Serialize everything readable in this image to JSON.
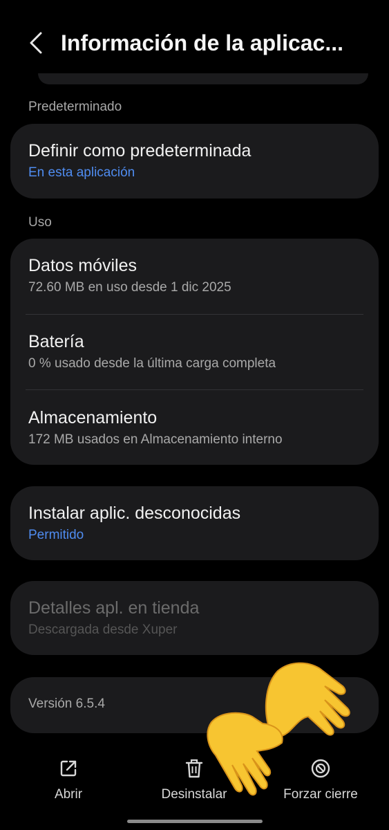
{
  "header": {
    "title": "Información de la aplicac...",
    "back_icon": "chevron-left-icon"
  },
  "sections": {
    "default_label": "Predeterminado",
    "usage_label": "Uso"
  },
  "default_card": {
    "title": "Definir como predeterminada",
    "subtitle": "En esta aplicación"
  },
  "usage": {
    "mobile_data": {
      "title": "Datos móviles",
      "subtitle": "72.60 MB en uso desde 1 dic 2025"
    },
    "battery": {
      "title": "Batería",
      "subtitle": "0 % usado desde la última carga completa"
    },
    "storage": {
      "title": "Almacenamiento",
      "subtitle": "172 MB usados en Almacenamiento interno"
    }
  },
  "install_unknown": {
    "title": "Instalar aplic. desconocidas",
    "subtitle": "Permitido"
  },
  "store_details": {
    "title": "Detalles apl. en tienda",
    "subtitle": "Descargada desde Xuper"
  },
  "version": {
    "text": "Versión 6.5.4"
  },
  "actions": {
    "open": {
      "label": "Abrir",
      "icon": "open-external-icon"
    },
    "uninstall": {
      "label": "Desinstalar",
      "icon": "trash-icon"
    },
    "force_stop": {
      "label": "Forzar cierre",
      "icon": "block-icon"
    }
  },
  "colors": {
    "background": "#000000",
    "card": "#1b1b1d",
    "accent_blue": "#4f8cf0",
    "hand_emoji": "#f7c531"
  },
  "overlay": {
    "icon": "open-hands-emoji-icon"
  }
}
